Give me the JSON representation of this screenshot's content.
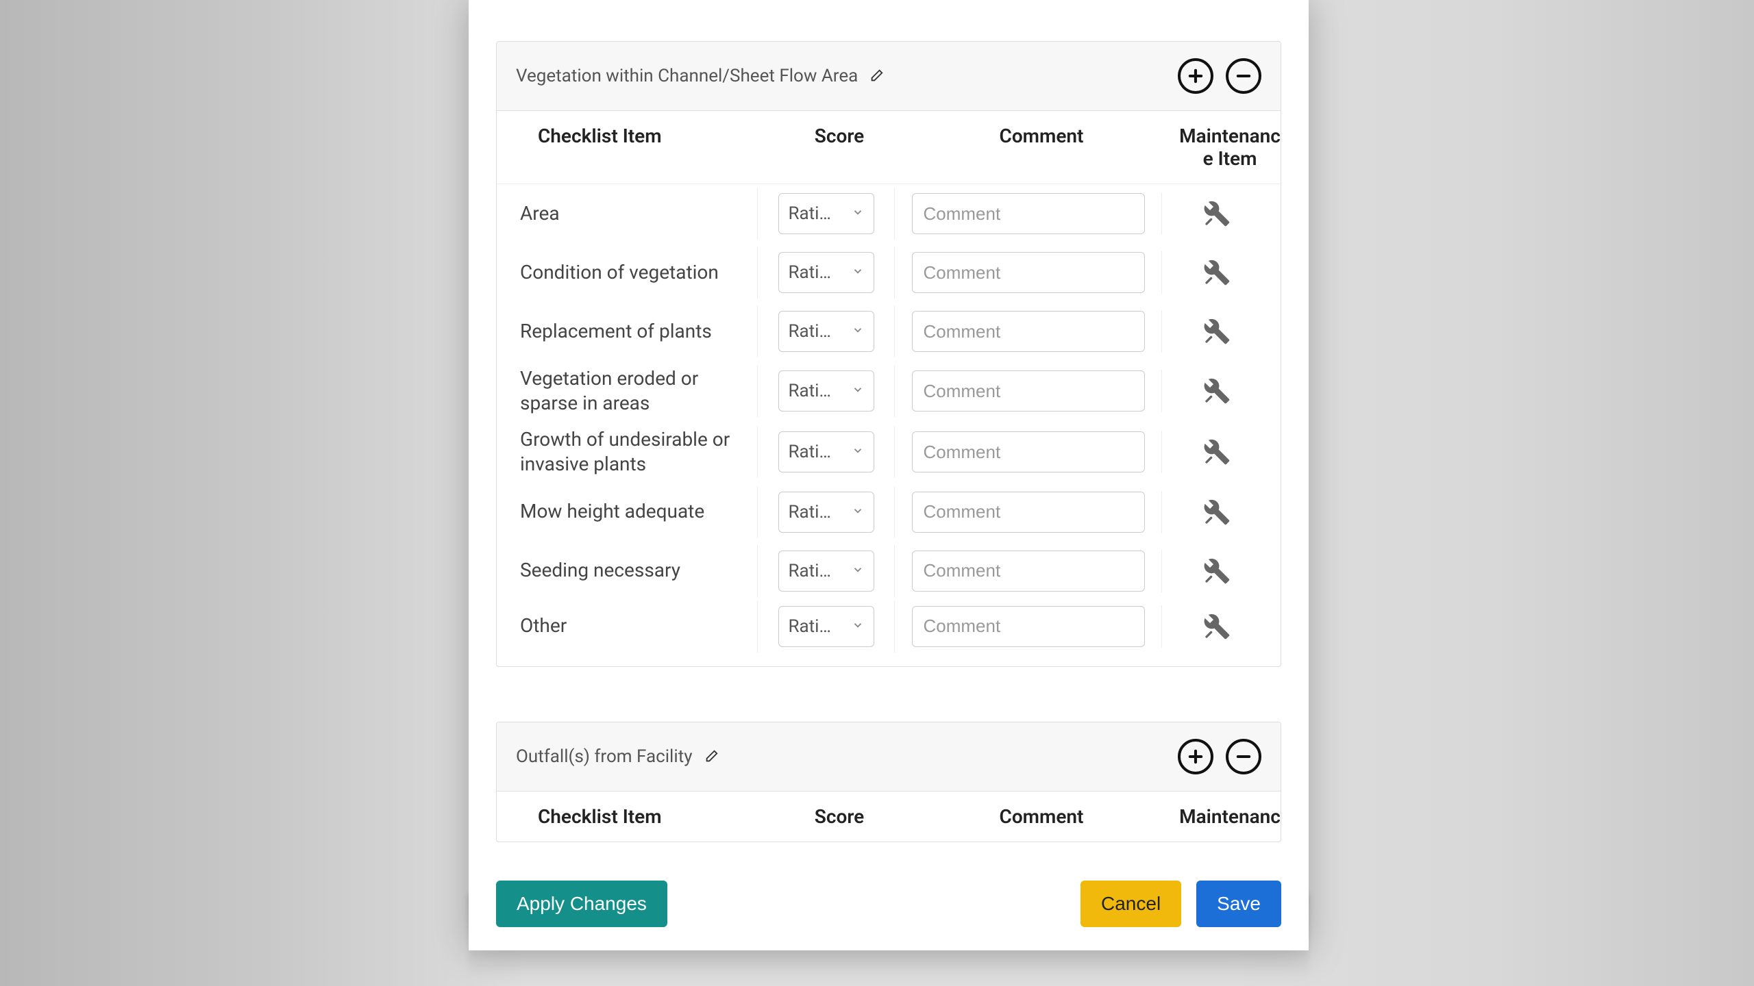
{
  "columns": {
    "item": "Checklist Item",
    "score": "Score",
    "comment": "Comment",
    "maintenance": "Maintenance Item"
  },
  "scorePlaceholder": "Rati…",
  "commentPlaceholder": "Comment",
  "sections": [
    {
      "title": "Vegetation within Channel/Sheet Flow Area",
      "rows": [
        {
          "label": "Area"
        },
        {
          "label": "Condition of vegetation"
        },
        {
          "label": "Replacement of plants"
        },
        {
          "label": "Vegetation eroded or sparse in areas"
        },
        {
          "label": "Growth of undesirable or invasive plants"
        },
        {
          "label": "Mow height adequate"
        },
        {
          "label": "Seeding necessary"
        },
        {
          "label": "Other"
        }
      ]
    },
    {
      "title": "Outfall(s) from Facility",
      "rows": []
    }
  ],
  "footer": {
    "apply": "Apply Changes",
    "cancel": "Cancel",
    "save": "Save"
  }
}
